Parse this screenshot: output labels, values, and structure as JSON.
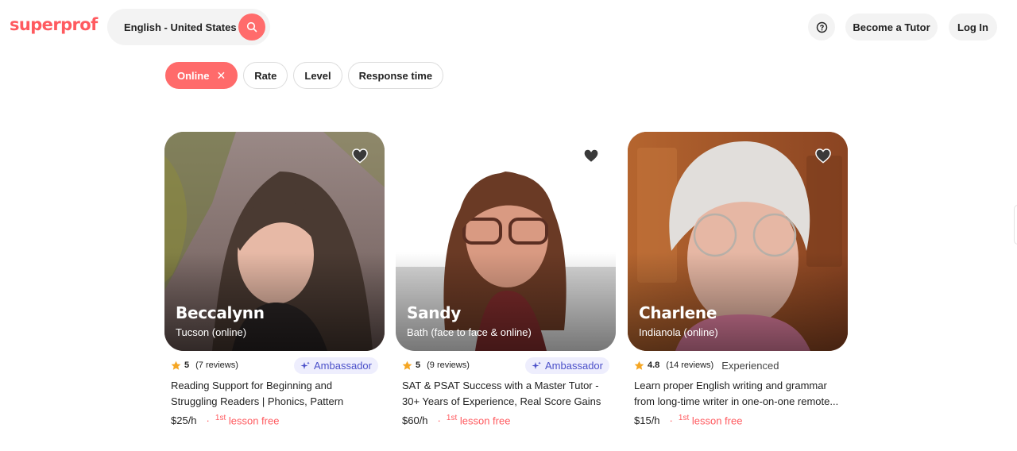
{
  "header": {
    "logo": "superprof",
    "search_label": "English - United States",
    "become_tutor": "Become a Tutor",
    "login": "Log In"
  },
  "filters": {
    "online": "Online",
    "rate": "Rate",
    "level": "Level",
    "response_time": "Response time"
  },
  "tutors": [
    {
      "name": "Beccalynn",
      "location": "Tucson (online)",
      "rating": "5",
      "reviews": "(7 reviews)",
      "badge": "Ambassador",
      "description": "Reading Support for Beginning and Struggling Readers | Phonics, Pattern Recognition,...",
      "price": "$25/h",
      "free_sup": "1st",
      "free_text": "lesson free"
    },
    {
      "name": "Sandy",
      "location": "Bath (face to face & online)",
      "rating": "5",
      "reviews": "(9 reviews)",
      "badge": "Ambassador",
      "description": "SAT & PSAT Success with a Master Tutor - 30+ Years of Experience, Real Score Gains",
      "price": "$60/h",
      "free_sup": "1st",
      "free_text": "lesson free"
    },
    {
      "name": "Charlene",
      "location": "Indianola (online)",
      "rating": "4.8",
      "reviews": "(14 reviews)",
      "tag": "Experienced",
      "description": "Learn proper English writing and grammar from long-time writer in one-on-one remote...",
      "price": "$15/h",
      "free_sup": "1st",
      "free_text": "lesson free"
    }
  ],
  "colors": {
    "brand": "#ff5a5f",
    "active_chip": "#ff6b6b",
    "badge_bg": "#eeeefd",
    "badge_text": "#4b50c9",
    "star": "#f5a623"
  },
  "icons": [
    "search-icon",
    "help-icon",
    "close-icon",
    "heart-icon",
    "star-icon",
    "sparkle-icon"
  ]
}
